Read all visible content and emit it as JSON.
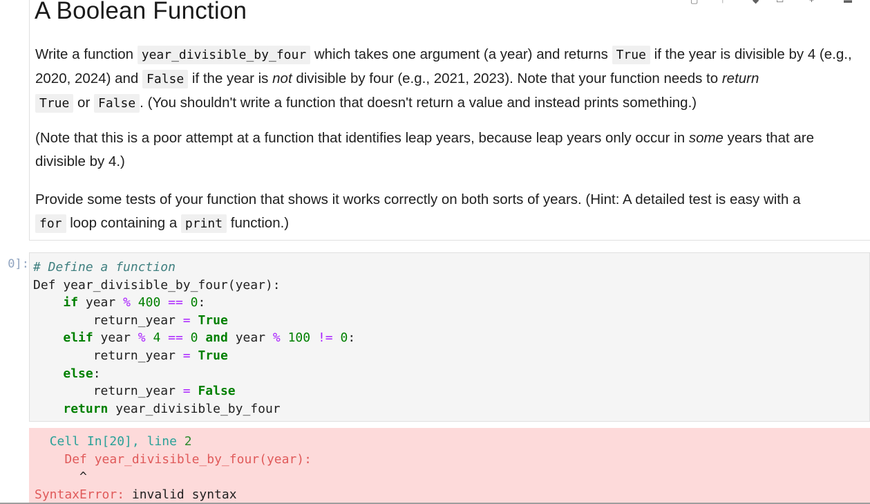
{
  "markdown": {
    "title": "A Boolean Function",
    "p1": {
      "t1": "Write a function ",
      "c1": "year_divisible_by_four",
      "t2": " which takes one argument (a year) and returns ",
      "c2": "True",
      "t3": " if the year is divisible by 4 (e.g., 2020, 2024) and ",
      "c3": "False",
      "t4": " if the year is ",
      "e1": "not",
      "t5": " divisible by four (e.g., 2021, 2023). Note that your function needs to ",
      "e2": "return",
      "t6": " ",
      "c4": "True",
      "t7": " or ",
      "c5": "False",
      "t8": ". (You shouldn't write a function that doesn't return a value and instead prints something.)"
    },
    "p2": {
      "t1": "(Note that this is a poor attempt at a function that identifies leap years, because leap years only occur in ",
      "e1": "some",
      "t2": " years that are divisible by 4.)"
    },
    "p3": {
      "t1": "Provide some tests of your function that shows it works correctly on both sorts of years. (Hint: A detailed test is easy with a ",
      "c1": "for",
      "t2": " loop containing a ",
      "c2": "print",
      "t3": " function.)"
    }
  },
  "code_cell": {
    "prompt": "0]:",
    "lines": {
      "l1_comment": "# Define a function",
      "l2_a": "Def year_divisible_by_four(year):",
      "l3_kw": "if",
      "l3_a": " year ",
      "l3_op1": "%",
      "l3_b": " ",
      "l3_n1": "400",
      "l3_c": " ",
      "l3_op2": "==",
      "l3_d": " ",
      "l3_n2": "0",
      "l3_e": ":",
      "l4_a": "return_year ",
      "l4_op": "=",
      "l4_b": " ",
      "l4_kw": "True",
      "l5_kw": "elif",
      "l5_a": " year ",
      "l5_op1": "%",
      "l5_b": " ",
      "l5_n1": "4",
      "l5_c": " ",
      "l5_op2": "==",
      "l5_d": " ",
      "l5_n2": "0",
      "l5_e": " ",
      "l5_kw2": "and",
      "l5_f": " year ",
      "l5_op3": "%",
      "l5_g": " ",
      "l5_n3": "100",
      "l5_h": " ",
      "l5_op4": "!=",
      "l5_i": " ",
      "l5_n4": "0",
      "l5_j": ":",
      "l6_a": "return_year ",
      "l6_op": "=",
      "l6_b": " ",
      "l6_kw": "True",
      "l7_kw": "else",
      "l7_a": ":",
      "l8_a": "return_year ",
      "l8_op": "=",
      "l8_b": " ",
      "l8_kw": "False",
      "l9_kw": "return",
      "l9_a": " year_divisible_by_four"
    }
  },
  "error": {
    "cell_label": "Cell In[20], line ",
    "line_no": "2",
    "code_line": "Def year_divisible_by_four(year):",
    "caret": "^",
    "type": "SyntaxError:",
    "message": " invalid syntax"
  },
  "colors": {
    "keyword": "#008000",
    "operator": "#aa22ff",
    "comment": "#408080",
    "error_bg": "#fddada",
    "code_bg": "#f5f5f5"
  }
}
